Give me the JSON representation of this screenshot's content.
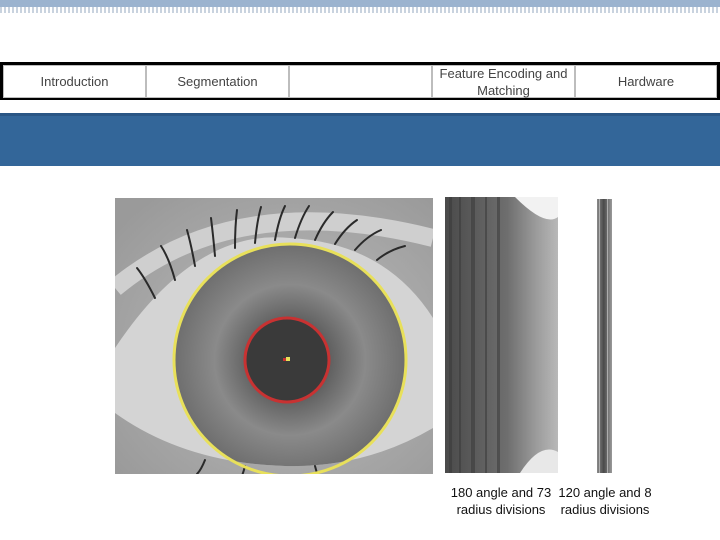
{
  "nav": {
    "tabs": [
      {
        "label": "Introduction"
      },
      {
        "label": "Segmentation"
      },
      {
        "label": ""
      },
      {
        "label": "Feature Encoding and Matching"
      },
      {
        "label": "Hardware"
      }
    ]
  },
  "figure": {
    "caption_a": "180 angle and 73 radius divisions",
    "caption_b": "120 angle and 8 radius divisions",
    "iris_outline_color": "#e8e05a",
    "pupil_outline_color": "#c83232"
  }
}
